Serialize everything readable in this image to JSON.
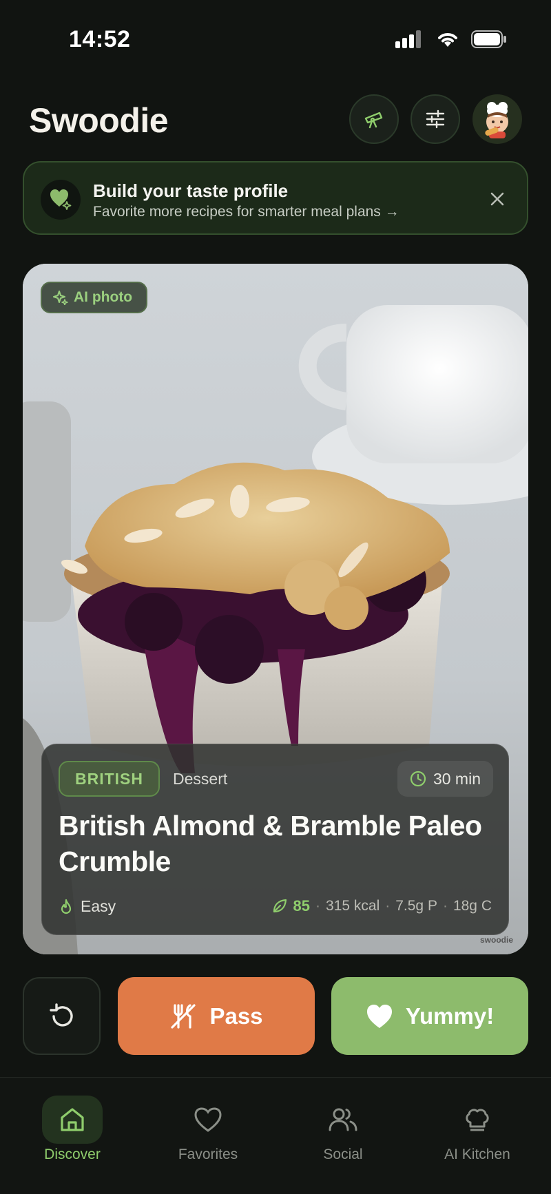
{
  "status_bar": {
    "time": "14:52"
  },
  "header": {
    "title": "Swoodie",
    "explore_icon": "telescope-icon",
    "filter_icon": "sliders-icon",
    "avatar_icon": "chef-avatar"
  },
  "banner": {
    "title": "Build your taste profile",
    "subtitle": "Favorite more recipes for smarter meal plans →",
    "icon": "heart-sparkle-icon"
  },
  "card": {
    "badge": "AI photo",
    "watermark": "swoodie",
    "cuisine": "BRITISH",
    "type": "Dessert",
    "time": "30 min",
    "title": "British Almond & Bramble Paleo Crumble",
    "difficulty": "Easy",
    "score": "85",
    "kcal": "315 kcal",
    "protein": "7.5g P",
    "carbs": "18g C"
  },
  "actions": {
    "undo_icon": "undo-icon",
    "pass_label": "Pass",
    "yummy_label": "Yummy!"
  },
  "nav": {
    "items": [
      {
        "label": "Discover",
        "icon": "home-icon",
        "active": true
      },
      {
        "label": "Favorites",
        "icon": "heart-icon",
        "active": false
      },
      {
        "label": "Social",
        "icon": "users-icon",
        "active": false
      },
      {
        "label": "AI Kitchen",
        "icon": "chef-hat-icon",
        "active": false
      }
    ]
  },
  "colors": {
    "background": "#111411",
    "accent_green": "#8dbb6c",
    "pass_orange": "#e07a47",
    "banner_bg": "#1c2a19"
  }
}
